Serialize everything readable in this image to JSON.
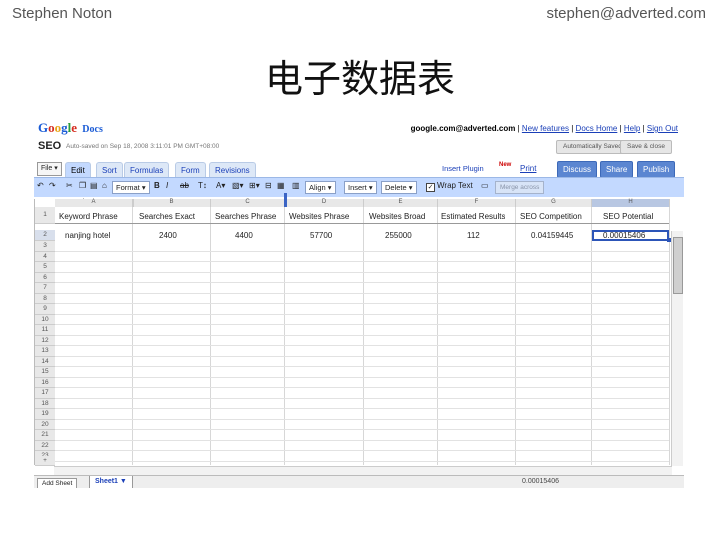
{
  "slide": {
    "author": "Stephen Noton",
    "email": "stephen@adverted.com",
    "title": "电子数据表"
  },
  "app": {
    "logo_word": "Google",
    "logo_suffix": "Docs",
    "account": "google.com@adverted.com",
    "links": [
      "New features",
      "Docs Home",
      "Help",
      "Sign Out"
    ],
    "doc_name": "SEO",
    "saved_status": "Auto-saved on Sep 18, 2008 3:11:01 PM GMT+08:00",
    "autosave_button": "Automatically Saved",
    "save_close_button": "Save & close"
  },
  "menu": {
    "file": "File ▾",
    "tabs": [
      "Edit",
      "Sort",
      "Formulas",
      "Form",
      "Revisions"
    ],
    "insert_plugin": "Insert Plugin",
    "new_badge": "New",
    "print": "Print",
    "actions": [
      "Discuss",
      "Share",
      "Publish"
    ]
  },
  "toolbar": {
    "format": "Format ▾",
    "bold": "B",
    "italic": "I",
    "strike": "ab",
    "align": "Align ▾",
    "insert": "Insert ▾",
    "delete": "Delete ▾",
    "wrap_text": "Wrap Text",
    "merge": "Merge across"
  },
  "grid": {
    "columns": [
      "A",
      "B",
      "C",
      "D",
      "E",
      "F",
      "G",
      "H"
    ],
    "selected_column": "H",
    "headers": [
      "Keyword Phrase",
      "Searches Exact",
      "Searches Phrase",
      "Websites Phrase",
      "Websites Broad",
      "Estimated Results",
      "SEO Competition",
      "SEO Potential"
    ],
    "row2": [
      "nanjing hotel",
      "2400",
      "4400",
      "57700",
      "255000",
      "112",
      "0.04159445",
      "0.00015406"
    ],
    "row_numbers": [
      "1",
      "2",
      "3",
      "4",
      "5",
      "6",
      "7",
      "8",
      "9",
      "10",
      "11",
      "12",
      "13",
      "14",
      "15",
      "16",
      "17",
      "18",
      "19",
      "20",
      "21",
      "22",
      "23"
    ],
    "add_row": "+"
  },
  "footer": {
    "add_sheet": "Add Sheet",
    "sheet_tab": "Sheet1 ▼",
    "sum_value": "0.00015406"
  }
}
